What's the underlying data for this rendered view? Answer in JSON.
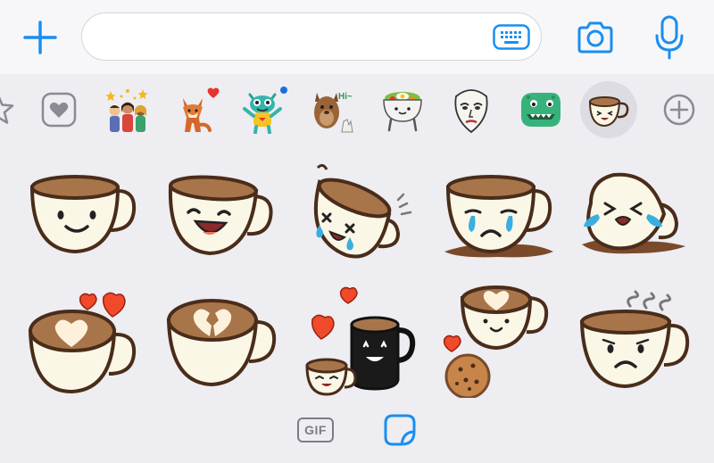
{
  "compose": {
    "placeholder": "",
    "value": ""
  },
  "icons": {
    "add": "plus-icon",
    "keyboard": "keyboard-icon",
    "camera": "camera-icon",
    "microphone": "microphone-icon",
    "favorites": "heart-icon",
    "add_pack": "plus-circle-icon",
    "sticker_tab": "sticker-icon"
  },
  "colors": {
    "accent": "#1a8ef0",
    "inactive": "#7c7c84",
    "coffee": "#a8754a",
    "cup": "#fbf7e6",
    "heart": "#f04a2a"
  },
  "tray": {
    "packs": [
      "recent-stars",
      "favorites",
      "friends-celebrating",
      "fox-heart",
      "monster",
      "dog-hi",
      "bibimbap",
      "mask-face",
      "dinosaur",
      "coffee-cups",
      "add-pack"
    ],
    "selected": "coffee-cups"
  },
  "bottom_bar": {
    "gif_label": "GIF",
    "active_tab": "stickers"
  },
  "stickers": [
    "cup-smiling",
    "cup-laughing",
    "cup-spilling-crying",
    "cup-sad-tears",
    "cup-tipped-crying",
    "cup-heart-latte",
    "cup-broken-heart-latte",
    "cup-and-mug-in-love",
    "latte-with-cookie",
    "cup-steaming-sad"
  ]
}
